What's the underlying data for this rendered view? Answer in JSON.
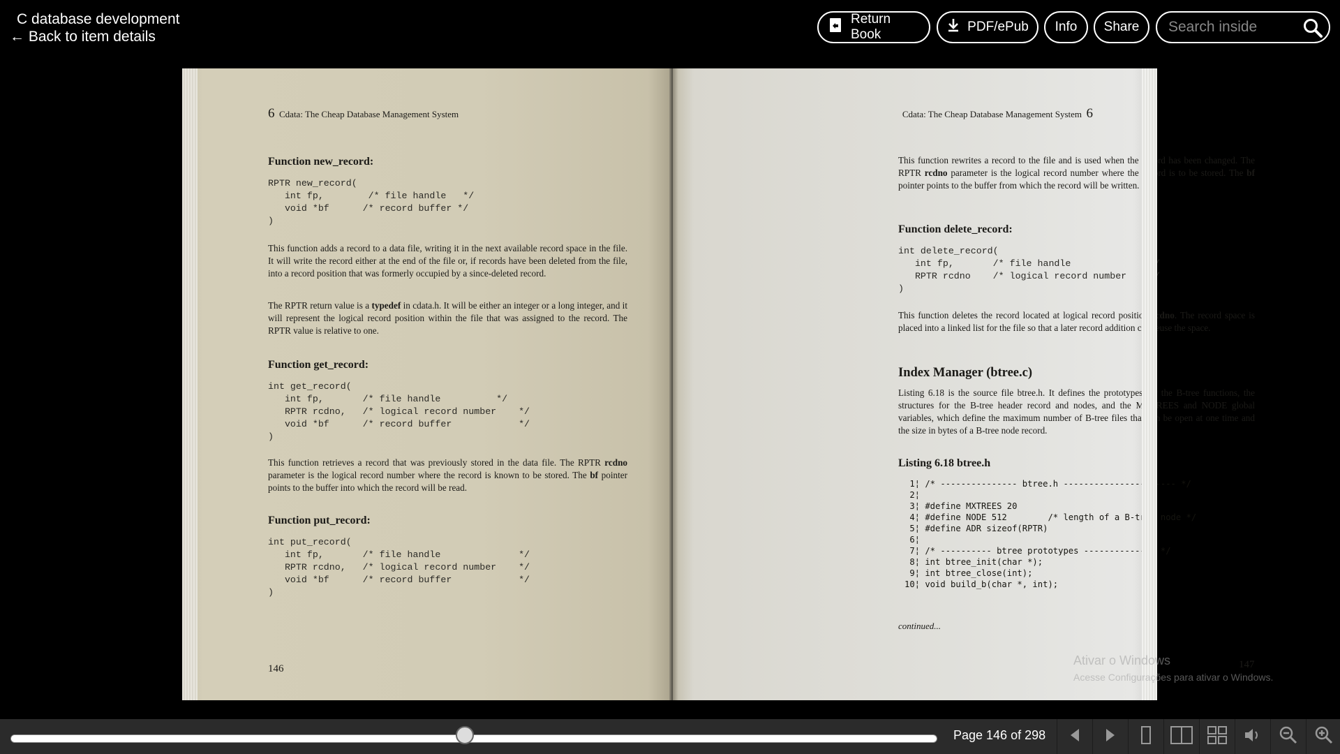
{
  "header": {
    "title": "C database development",
    "back_link": "← Back to item details",
    "buttons": {
      "return_book": "Return Book",
      "pdf_epub": "PDF/ePub",
      "info": "Info",
      "share": "Share"
    },
    "search_placeholder": "Search inside"
  },
  "left_page": {
    "chapter_num": "6",
    "running_head": "Cdata: The Cheap Database Management System",
    "h_new": "Function new_record:",
    "code_new": "RPTR new_record(\n   int fp,        /* file handle   */\n   void *bf      /* record buffer */\n)",
    "p_new1": "This function adds a record to a data file, writing it in the next available record space in the file. It will write the record either at the end of the file or, if records have been deleted from the file, into a record position that was formerly occupied by a since-deleted record.",
    "p_new2_a": "The RPTR return value is a ",
    "p_new2_b": "typedef",
    "p_new2_c": " in cdata.h. It will be either an integer or a long integer, and it will represent the logical record position within the file that was assigned to the record. The RPTR value is relative to one.",
    "h_get": "Function get_record:",
    "code_get": "int get_record(\n   int fp,       /* file handle          */\n   RPTR rcdno,   /* logical record number    */\n   void *bf      /* record buffer            */\n)",
    "p_get_a": "This function retrieves a record that was previously stored in the data file. The RPTR ",
    "p_get_b": "rcdno",
    "p_get_c": " parameter is the logical record number where the record is known to be stored. The ",
    "p_get_d": "bf",
    "p_get_e": " pointer points to the buffer into which the record will be read.",
    "h_put": "Function put_record:",
    "code_put": "int put_record(\n   int fp,       /* file handle              */\n   RPTR rcdno,   /* logical record number    */\n   void *bf      /* record buffer            */\n)",
    "page_number": "146"
  },
  "right_page": {
    "running_head": "Cdata: The Cheap Database Management System",
    "chapter_num": "6",
    "p_put_a": "This function rewrites a record to the file and is used when the record has been changed. The RPTR ",
    "p_put_b": "rcdno",
    "p_put_c": " parameter is the logical record number where the record is to be stored. The ",
    "p_put_d": "bf",
    "p_put_e": " pointer points to the buffer from which the record will be written.",
    "h_del": "Function delete_record:",
    "code_del": "int delete_record(\n   int fp,       /* file handle              */\n   RPTR rcdno    /* logical record number    */\n)",
    "p_del_a": "This function deletes the record located at logical record position ",
    "p_del_b": "rcdno",
    "p_del_c": ". The record space is placed into a linked list for the file so that a later record addition can reuse the space.",
    "h_index": "Index Manager (btree.c)",
    "p_index": "Listing 6.18 is the source file btree.h. It defines the prototypes for the B-tree functions, the structures for the B-tree header record and nodes, and the MXTREES and NODE global variables, which define the maximum number of B-tree files that can be open at one time and the size in bytes of a B-tree node record.",
    "h_listing": "Listing 6.18 btree.h",
    "listing": " 1¦ /* --------------- btree.h ---------------------- */\n 2¦\n 3¦ #define MXTREES 20\n 4¦ #define NODE 512        /* length of a B-tree node */\n 5¦ #define ADR sizeof(RPTR)\n 6¦\n 7¦ /* ---------- btree prototypes -------------- */\n 8¦ int btree_init(char *);\n 9¦ int btree_close(int);\n10¦ void build_b(char *, int);",
    "continued": "continued...",
    "page_number": "147"
  },
  "watermark": {
    "line1": "Ativar o Windows",
    "line2": "Acesse Configurações para ativar o Windows."
  },
  "footer": {
    "progress": 0.49,
    "page_indicator": "Page 146 of 298"
  },
  "icons": [
    "return-book-icon",
    "download-icon",
    "search-icon",
    "prev-page-icon",
    "next-page-icon",
    "one-page-view-icon",
    "two-page-view-icon",
    "thumbnail-view-icon",
    "read-aloud-icon",
    "zoom-out-icon",
    "zoom-in-icon"
  ]
}
